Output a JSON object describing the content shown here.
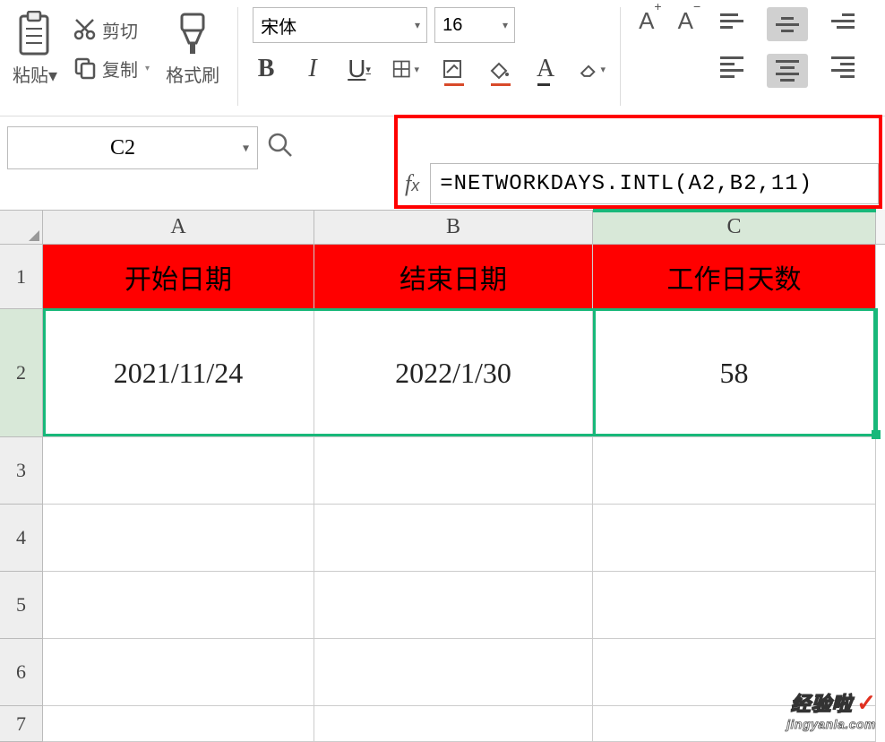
{
  "toolbar": {
    "paste_label": "粘贴",
    "cut_label": "剪切",
    "copy_label": "复制",
    "format_painter_label": "格式刷",
    "font_name": "宋体",
    "font_size": "16",
    "bold": "B",
    "italic": "I",
    "underline": "U",
    "increase_font": "A⁺",
    "decrease_font": "A⁻"
  },
  "namebox": "C2",
  "formula": "=NETWORKDAYS.INTL(A2,B2,11)",
  "columns": {
    "A": "A",
    "B": "B",
    "C": "C"
  },
  "rows": [
    "1",
    "2",
    "3",
    "4",
    "5",
    "6",
    "7"
  ],
  "headers": {
    "A": "开始日期",
    "B": "结束日期",
    "C": "工作日天数"
  },
  "data_row": {
    "A": "2021/11/24",
    "B": "2022/1/30",
    "C": "58"
  },
  "watermark": {
    "line1": "经验啦",
    "line2": "jingyanla.com"
  }
}
